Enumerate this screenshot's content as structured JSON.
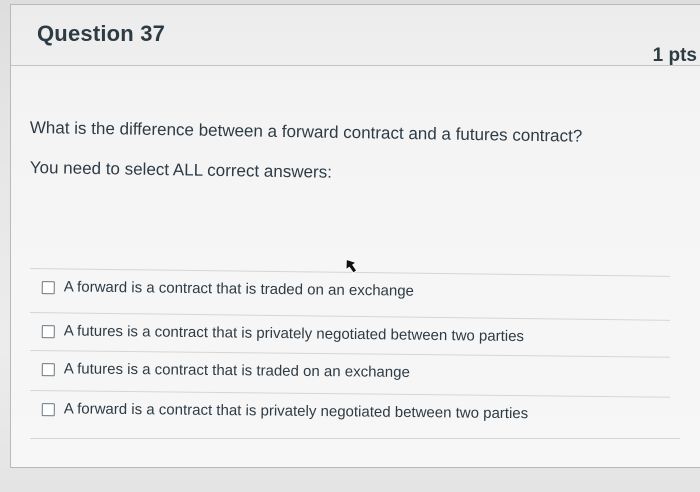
{
  "question": {
    "title": "Question 37",
    "points": "1 pts",
    "prompt": "What is the difference between a forward contract and a futures contract?",
    "instruction": "You need to select ALL correct answers:"
  },
  "answers": [
    {
      "label": "A forward is a contract that is traded on an exchange",
      "checked": false
    },
    {
      "label": "A futures is a contract that is privately negotiated between two parties",
      "checked": false
    },
    {
      "label": "A futures is a contract that is traded on an exchange",
      "checked": false
    },
    {
      "label": "A forward is a contract that is privately negotiated between two parties",
      "checked": false
    }
  ],
  "cursor": {
    "icon": "mouse-pointer-icon"
  },
  "colors": {
    "text": "#2d3b45",
    "background": "#f5f5f5",
    "border": "#c4c4c4"
  }
}
